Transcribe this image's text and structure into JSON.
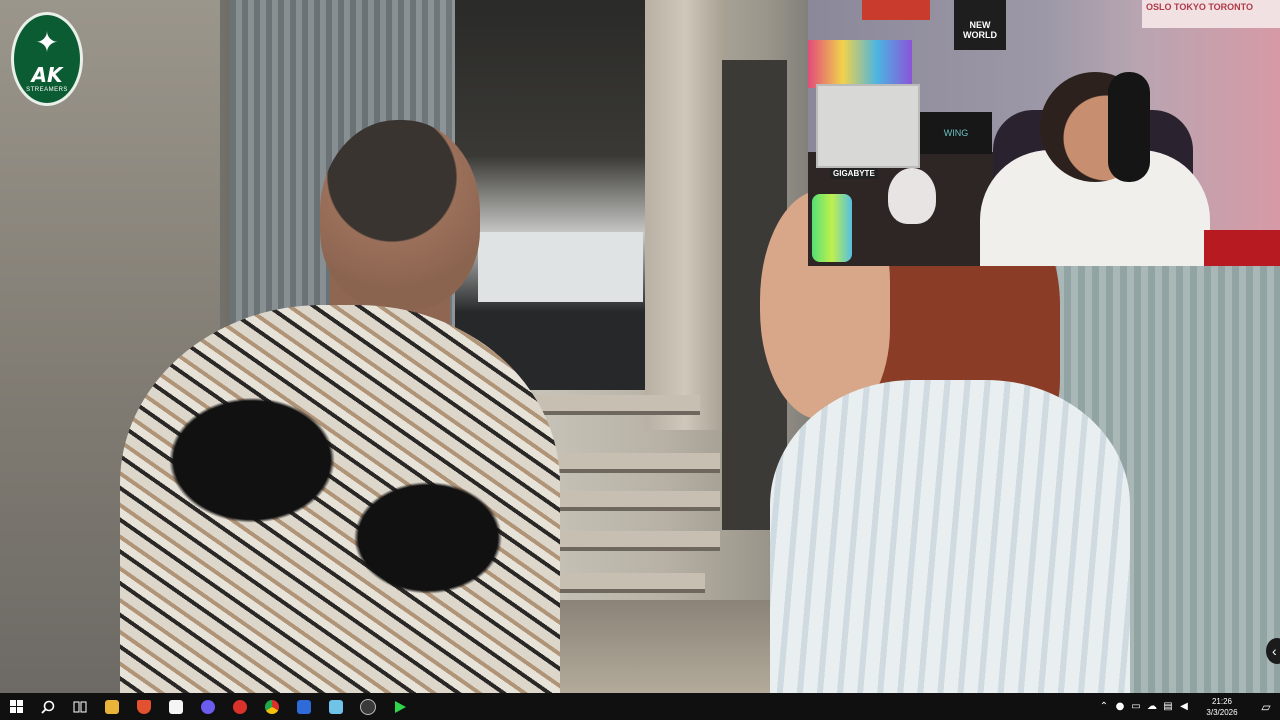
{
  "scene": {
    "logo": {
      "text": "AK",
      "subtext": "STREAMERS"
    },
    "webcam": {
      "poster_new_world": "NEW WORLD",
      "poster_cities": "OSLO  TOKYO  TORONTO",
      "case_brand": "GIGABYTE",
      "speaker_label": "WING"
    }
  },
  "taskbar": {
    "icons": [
      "windows-start-icon",
      "search-icon",
      "task-view-icon",
      "file-explorer-icon",
      "brave-icon",
      "calendar-app-icon",
      "messenger-icon",
      "opera-icon",
      "chrome-icon",
      "app-blue-icon",
      "notepad-icon",
      "obs-icon",
      "media-player-icon"
    ],
    "app_colors": [
      "#e8b43a",
      "#e2522e",
      "#f5f5f5",
      "#6b5cf0",
      "#d9322b",
      "#4a8df0",
      "#2e6bd9",
      "#6fc3e8",
      "#3a3a3a",
      "#2fd64a"
    ],
    "clock_time": "21:26",
    "clock_date": "3/3/2026"
  }
}
